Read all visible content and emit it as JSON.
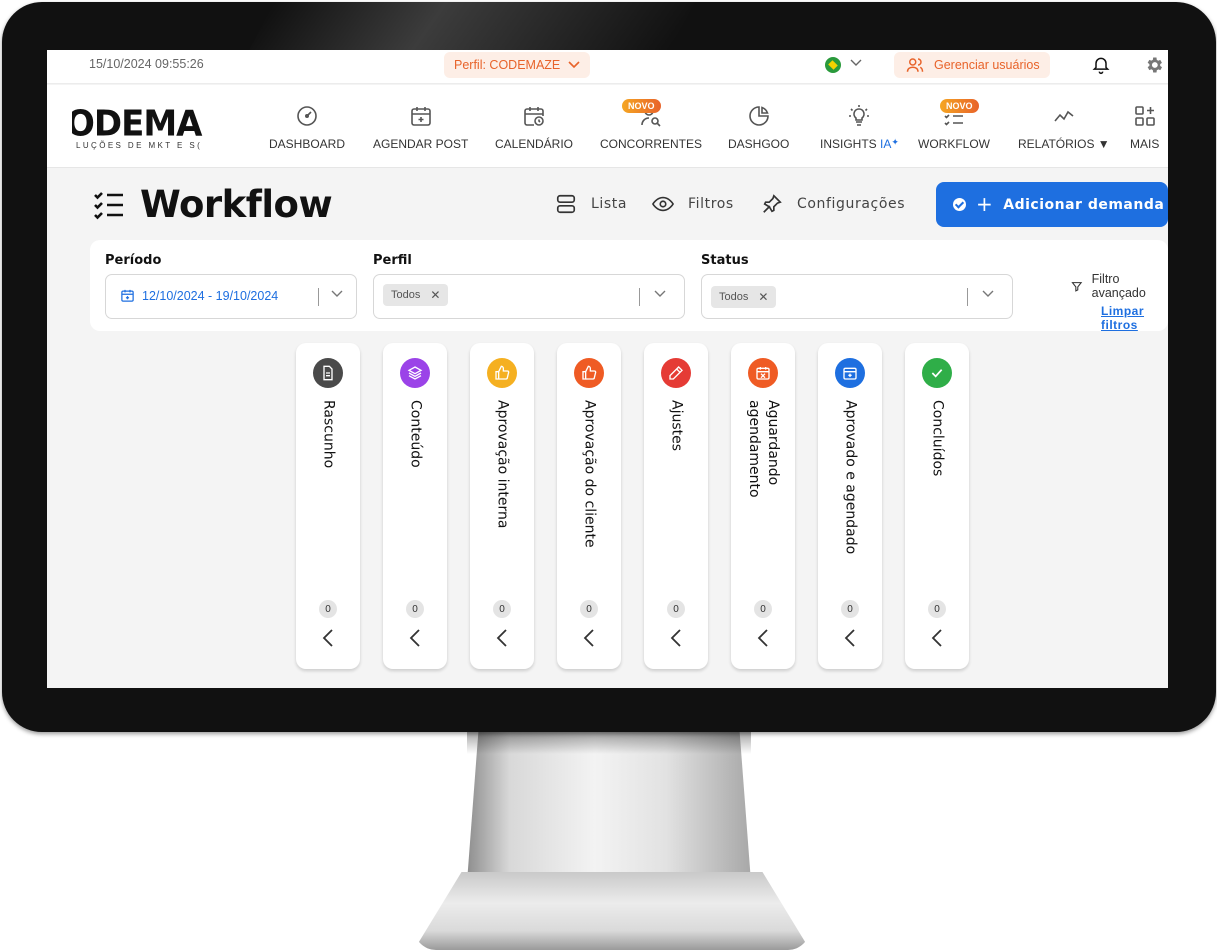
{
  "topbar": {
    "datetime": "15/10/2024  09:55:26",
    "profile_label": "Perfil: CODEMAZE",
    "manage_users_label": "Gerenciar usuários"
  },
  "brand": {
    "logo_text": "ODEMA",
    "logo_subtext": "LUÇÕES DE MKT E S("
  },
  "nav": {
    "items": [
      {
        "label": "DASHBOARD",
        "icon": "gauge-icon"
      },
      {
        "label": "AGENDAR POST",
        "icon": "calendar-plus-icon"
      },
      {
        "label": "CALENDÁRIO",
        "icon": "calendar-clock-icon"
      },
      {
        "label": "CONCORRENTES",
        "icon": "user-search-icon",
        "badge": "NOVO"
      },
      {
        "label": "DASHGOO",
        "icon": "pie-chart-icon"
      },
      {
        "label": "INSIGHTS",
        "suffix": "IA",
        "icon": "lightbulb-icon"
      },
      {
        "label": "WORKFLOW",
        "icon": "checklist-icon",
        "badge": "NOVO"
      },
      {
        "label": "RELATÓRIOS ▼",
        "icon": "trend-line-icon"
      },
      {
        "label": "MAIS",
        "icon": "apps-plus-icon"
      }
    ]
  },
  "page": {
    "title": "Workflow",
    "tools": {
      "list": "Lista",
      "filters": "Filtros",
      "settings": "Configurações"
    },
    "add_button": "Adicionar demanda"
  },
  "filters": {
    "period": {
      "label": "Período",
      "value": "12/10/2024 - 19/10/2024"
    },
    "profile": {
      "label": "Perfil",
      "tag": "Todos"
    },
    "status": {
      "label": "Status",
      "tag": "Todos"
    },
    "advanced": "Filtro avançado",
    "clear": "Limpar filtros"
  },
  "columns": [
    {
      "title": "Rascunho",
      "count": "0",
      "color": "#4a4a4a",
      "icon": "document-icon"
    },
    {
      "title": "Conteúdo",
      "count": "0",
      "color": "#9b43e8",
      "icon": "layers-icon"
    },
    {
      "title": "Aprovação interna",
      "count": "0",
      "color": "#f5b021",
      "icon": "thumbs-up-icon"
    },
    {
      "title": "Aprovação do cliente",
      "count": "0",
      "color": "#ef5b24",
      "icon": "thumbs-up-icon"
    },
    {
      "title": "Ajustes",
      "count": "0",
      "color": "#e53b35",
      "icon": "pencil-icon"
    },
    {
      "title": "Aguardando agendamento",
      "count": "0",
      "color": "#ef5b24",
      "icon": "calendar-x-icon"
    },
    {
      "title": "Aprovado e agendado",
      "count": "0",
      "color": "#1e6fe0",
      "icon": "calendar-check-icon"
    },
    {
      "title": "Concluídos",
      "count": "0",
      "color": "#2fae48",
      "icon": "check-icon"
    }
  ],
  "colors": {
    "accent": "#1e6fe0",
    "brand_orange": "#e8632a"
  }
}
